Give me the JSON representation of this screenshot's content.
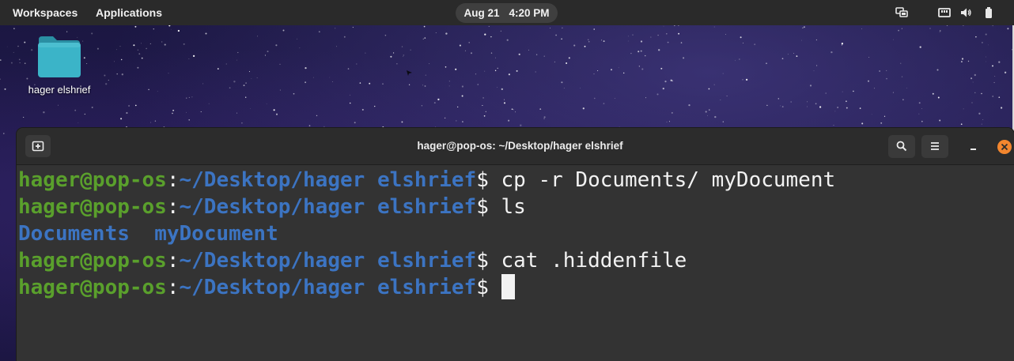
{
  "top_panel": {
    "workspaces_label": "Workspaces",
    "applications_label": "Applications",
    "clock": {
      "date": "Aug 21",
      "time": "4:20 PM"
    },
    "tray_icons": [
      "displays-icon",
      "network-icon",
      "volume-icon",
      "battery-icon"
    ]
  },
  "desktop": {
    "folder_label": "hager elshrief",
    "folder_color": "#3bb4c8"
  },
  "terminal": {
    "title": "hager@pop-os: ~/Desktop/hager elshrief",
    "header_icons": [
      "new-tab-icon",
      "search-icon",
      "menu-icon",
      "minimize-icon",
      "close-icon"
    ],
    "prompt_user": "hager@pop-os",
    "prompt_colon": ":",
    "prompt_path": "~/Desktop/hager elshrief",
    "prompt_symbol": "$",
    "lines": [
      {
        "type": "command",
        "text": " cp -r Documents/ myDocument"
      },
      {
        "type": "command",
        "text": " ls"
      },
      {
        "type": "output",
        "items": [
          "Documents",
          "myDocument"
        ]
      },
      {
        "type": "command",
        "text": " cat .hiddenfile"
      },
      {
        "type": "command",
        "text": " "
      }
    ]
  },
  "colors": {
    "panel_bg": "#2a2a2a",
    "terminal_bg": "#333333",
    "prompt_user": "#5aa02c",
    "prompt_path": "#3c74c2",
    "close_accent": "#f3862e"
  }
}
